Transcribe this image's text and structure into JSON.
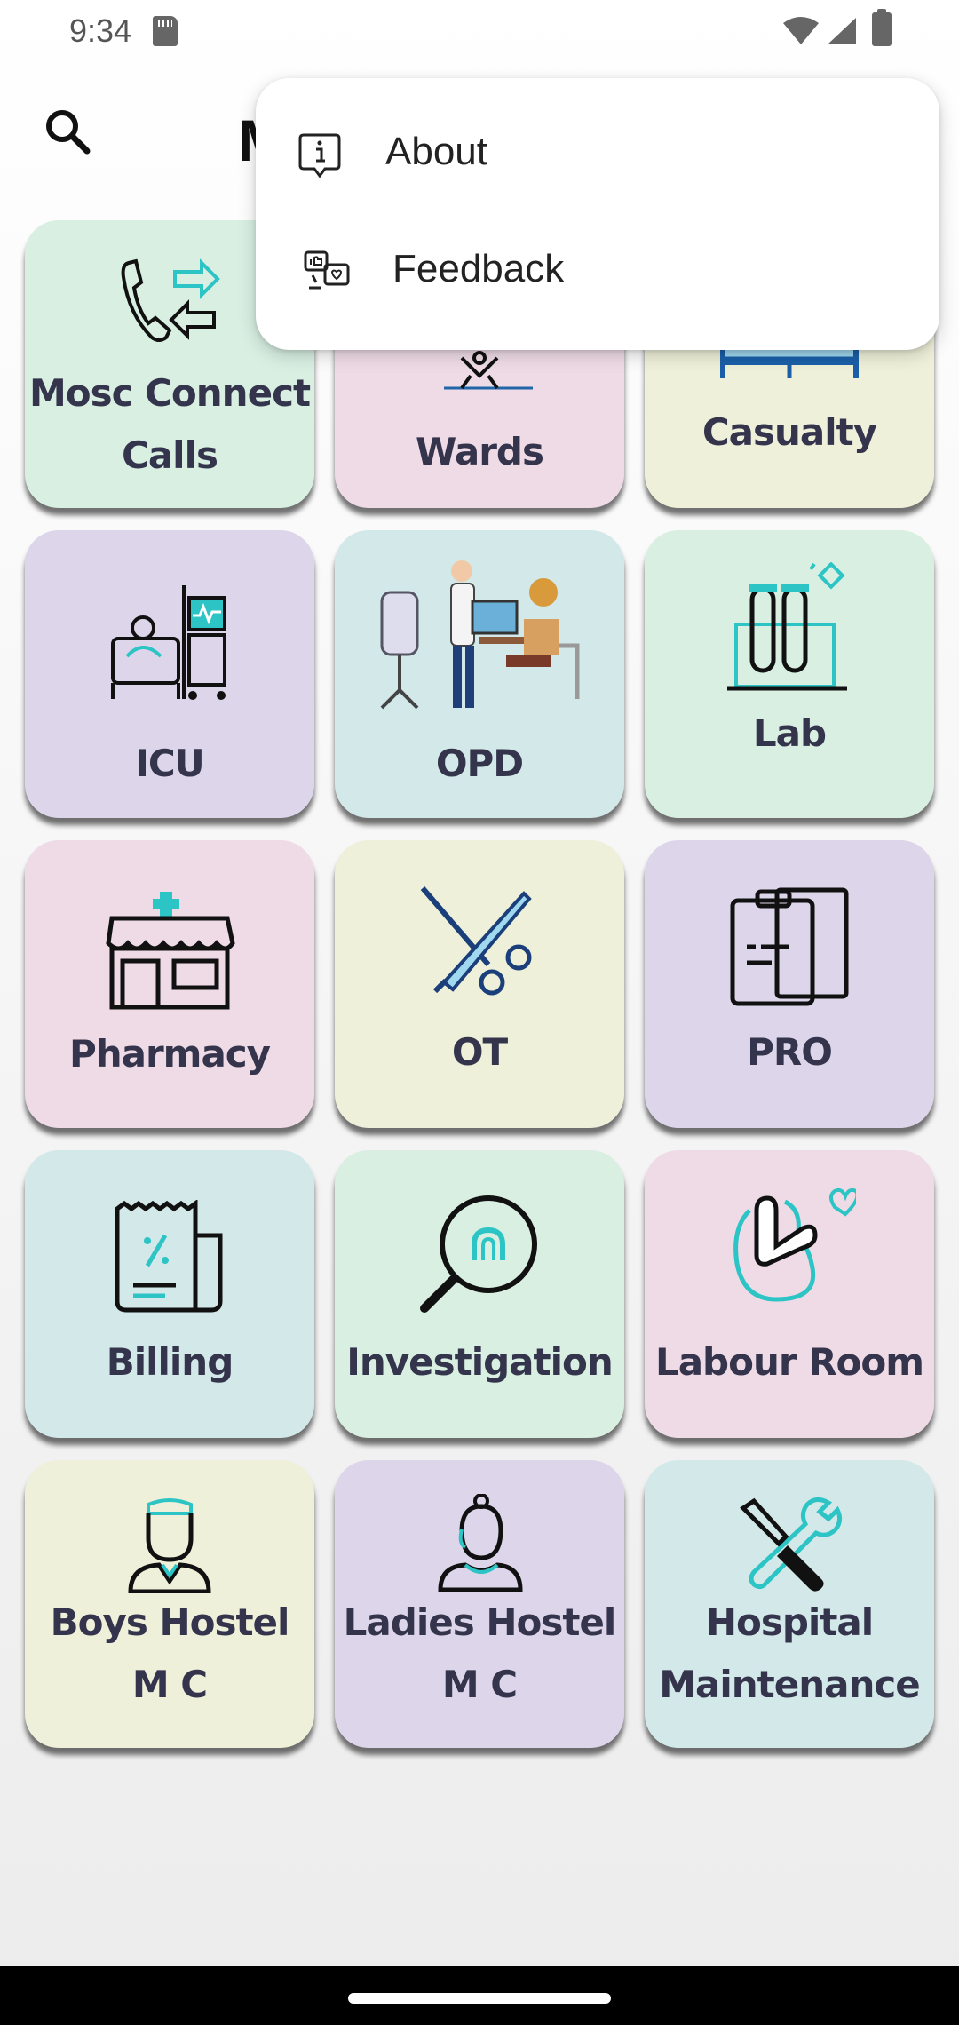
{
  "status_bar": {
    "time": "9:34"
  },
  "app_bar": {
    "title_partial": "M"
  },
  "menu": {
    "items": [
      {
        "label": "About",
        "icon": "info-icon"
      },
      {
        "label": "Feedback",
        "icon": "feedback-icon"
      }
    ]
  },
  "tiles": [
    {
      "line1": "Mosc Connect",
      "line2": "Calls",
      "icon": "phone-transfer-icon",
      "color": "#d8efe2"
    },
    {
      "line1": "Wards",
      "line2": "",
      "icon": "ward-icon",
      "color": "#efdbe6"
    },
    {
      "line1": "Casualty",
      "line2": "",
      "icon": "bed-icon",
      "color": "#eef0d9"
    },
    {
      "line1": "ICU",
      "line2": "",
      "icon": "icu-bed-icon",
      "color": "#ddd6ea"
    },
    {
      "line1": "OPD",
      "line2": "",
      "icon": "doctor-patient-icon",
      "color": "#d3e8e8"
    },
    {
      "line1": "Lab",
      "line2": "",
      "icon": "test-tubes-icon",
      "color": "#d8efe2"
    },
    {
      "line1": "Pharmacy",
      "line2": "",
      "icon": "pharmacy-store-icon",
      "color": "#efdbe6"
    },
    {
      "line1": "OT",
      "line2": "",
      "icon": "surgery-tools-icon",
      "color": "#eef0d9"
    },
    {
      "line1": "PRO",
      "line2": "",
      "icon": "clipboard-icon",
      "color": "#ddd6ea"
    },
    {
      "line1": "Billing",
      "line2": "",
      "icon": "receipt-icon",
      "color": "#d3e8e8"
    },
    {
      "line1": "Investigation",
      "line2": "",
      "icon": "magnifier-icon",
      "color": "#d8efe2"
    },
    {
      "line1": "Labour Room",
      "line2": "",
      "icon": "pregnancy-icon",
      "color": "#efdbe6"
    },
    {
      "line1": "Boys Hostel",
      "line2": "M C",
      "icon": "male-avatar-icon",
      "color": "#eef0d9"
    },
    {
      "line1": "Ladies Hostel",
      "line2": "M C",
      "icon": "female-avatar-icon",
      "color": "#ddd6ea"
    },
    {
      "line1": "Hospital",
      "line2": "Maintenance",
      "icon": "wrench-screwdriver-icon",
      "color": "#d3e8e8"
    }
  ]
}
